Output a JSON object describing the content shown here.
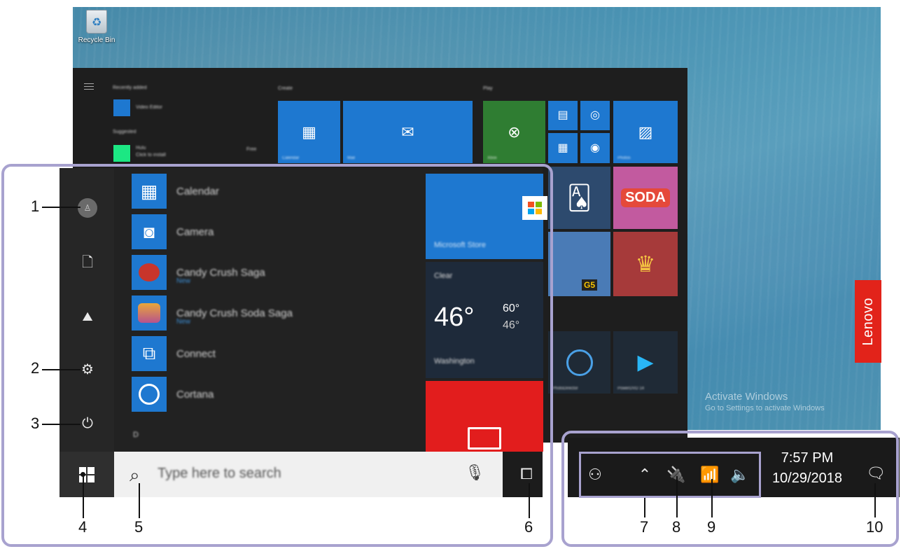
{
  "desktop": {
    "recycle_bin_label": "Recycle Bin",
    "brand": "Lenovo",
    "activation": {
      "title": "Activate Windows",
      "subtitle": "Go to Settings to activate Windows"
    }
  },
  "start_menu": {
    "recent": {
      "header": "Recently added",
      "item_label": "Video Editor"
    },
    "suggested": {
      "header": "Suggested",
      "item_label": "Hulu",
      "item_sub": "Click to install",
      "item_badge": "Free"
    },
    "groups": [
      {
        "label": "Create"
      },
      {
        "label": "Play"
      }
    ],
    "tiles": {
      "calendar": "Calendar",
      "mail": "Mail",
      "xbox": "Xbox",
      "photos": "Photos",
      "store": "Microsoft Store",
      "weather_cond": "Clear",
      "weather_temp": "46°",
      "weather_hi": "60°",
      "weather_lo": "46°",
      "weather_city": "Washington",
      "candy_tile_text": "SODA",
      "g5_tile_text": "G5",
      "photodirector": "PhotoDirector",
      "powerdvd": "PowerDVD 14"
    },
    "app_list": [
      {
        "name": "Calendar",
        "sub": ""
      },
      {
        "name": "Camera",
        "sub": ""
      },
      {
        "name": "Candy Crush Saga",
        "sub": "New"
      },
      {
        "name": "Candy Crush Soda Saga",
        "sub": "New"
      },
      {
        "name": "Connect",
        "sub": ""
      },
      {
        "name": "Cortana",
        "sub": ""
      }
    ],
    "section_letter": "D"
  },
  "taskbar": {
    "search_placeholder": "Type here to search",
    "time": "7:57 PM",
    "date": "10/29/2018"
  },
  "callouts": [
    "1",
    "2",
    "3",
    "4",
    "5",
    "6",
    "7",
    "8",
    "9",
    "10"
  ],
  "colors": {
    "frame": "#a8a2cf",
    "tile_blue": "#1e78d0",
    "tile_green": "#2f7d32",
    "tile_red": "#e21d1d",
    "lenovo_red": "#e2231a"
  }
}
